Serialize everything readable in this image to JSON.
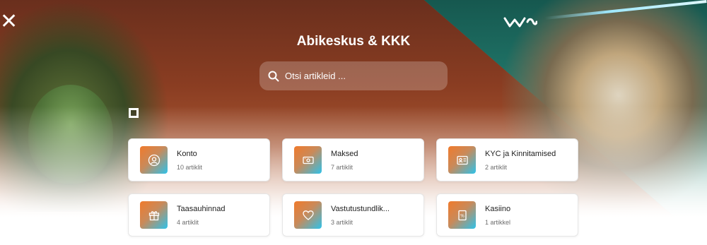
{
  "header": {
    "title": "Abikeskus & KKK",
    "close_icon": "close-icon",
    "logo_icon": "brand-wave-logo"
  },
  "search": {
    "placeholder": "Otsi artikleid ...",
    "value": "",
    "icon": "search-icon"
  },
  "categories": [
    {
      "name": "Konto",
      "count": "10 artiklit",
      "icon": "user-icon"
    },
    {
      "name": "Maksed",
      "count": "7 artiklit",
      "icon": "payment-icon"
    },
    {
      "name": "KYC ja Kinnitamised",
      "count": "2 artiklit",
      "icon": "id-card-icon"
    },
    {
      "name": "Taasauhinnad",
      "count": "4 artiklit",
      "icon": "gift-icon"
    },
    {
      "name": "Vastutustundlik...",
      "count": "3 artiklit",
      "icon": "heart-icon"
    },
    {
      "name": "Kasiino",
      "count": "1 artikkel",
      "icon": "casino-icon"
    }
  ],
  "colors": {
    "icon_gradient_start": "#f07a2c",
    "icon_gradient_end": "#2ec2ea",
    "hero_left": "#8a3d22",
    "hero_right": "#1f7266"
  }
}
